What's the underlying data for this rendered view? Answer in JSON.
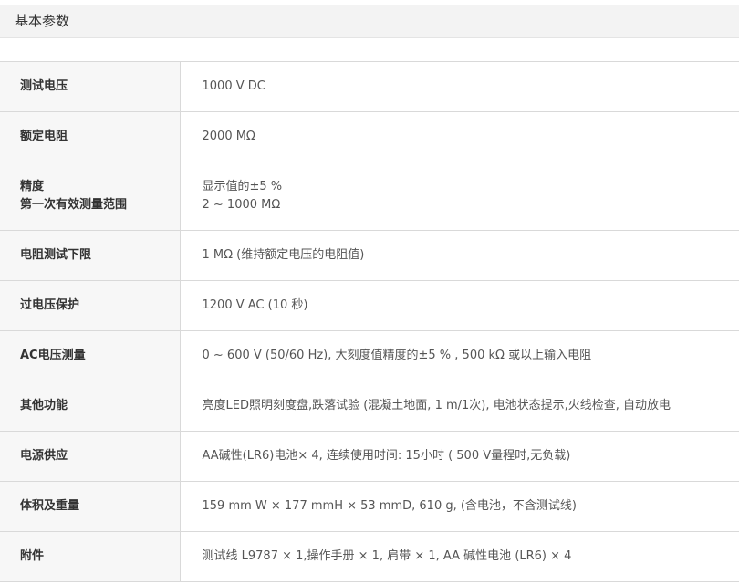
{
  "header": {
    "title": "基本参数"
  },
  "rows": [
    {
      "label": "测试电压",
      "value": "1000 V DC"
    },
    {
      "label": "额定电阻",
      "value": "2000 MΩ"
    },
    {
      "label_lines": [
        "精度",
        "第一次有效测量范围"
      ],
      "value_lines": [
        "显示值的±5 %",
        "2 ~ 1000 MΩ"
      ]
    },
    {
      "label": "电阻测试下限",
      "value": "1 MΩ (维持额定电压的电阻值)"
    },
    {
      "label": "过电压保护",
      "value": "1200 V AC (10 秒)"
    },
    {
      "label": "AC电压测量",
      "value": "0 ~ 600 V (50/60 Hz), 大刻度值精度的±5 % , 500 kΩ 或以上输入电阻"
    },
    {
      "label": "其他功能",
      "value": "亮度LED照明刻度盘,跌落试验 (混凝土地面, 1 m/1次), 电池状态提示,火线检查, 自动放电"
    },
    {
      "label": "电源供应",
      "value": "AA碱性(LR6)电池× 4, 连续使用时间: 15小时 ( 500 V量程时,无负载)"
    },
    {
      "label": "体积及重量",
      "value": "159 mm W × 177 mmH × 53 mmD, 610 g, (含电池，不含测试线)"
    },
    {
      "label": "附件",
      "value": "测试线 L9787 × 1,操作手册 × 1, 肩带 × 1, AA 碱性电池 (LR6) × 4"
    }
  ]
}
